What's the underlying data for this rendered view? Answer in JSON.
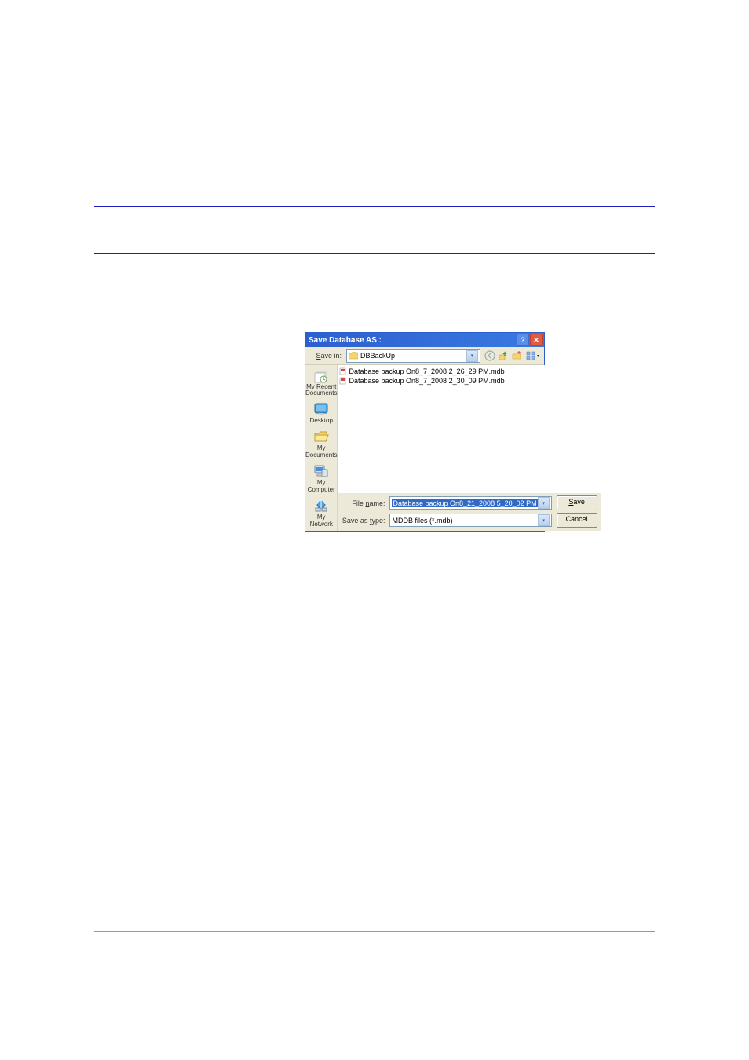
{
  "header_lines": {
    "top1": 262,
    "top2": 322
  },
  "dialog": {
    "title": "Save Database AS :",
    "save_in_label": "Save in:",
    "save_in_value": "DBBackUp",
    "places": [
      {
        "key": "recent",
        "label": "My Recent\nDocuments"
      },
      {
        "key": "desktop",
        "label": "Desktop"
      },
      {
        "key": "mydocs",
        "label": "My Documents"
      },
      {
        "key": "mycomputer",
        "label": "My Computer"
      },
      {
        "key": "mynetwork",
        "label": "My Network"
      }
    ],
    "files": [
      "Database backup On8_7_2008 2_26_29 PM.mdb",
      "Database backup On8_7_2008 2_30_09 PM.mdb"
    ],
    "filename_label": "File name:",
    "filename_value": "Database backup On8_21_2008 5_20_02 PM",
    "savetype_label": "Save as type:",
    "savetype_value": "MDDB files (*.mdb)",
    "save_button": "Save",
    "cancel_button": "Cancel"
  }
}
